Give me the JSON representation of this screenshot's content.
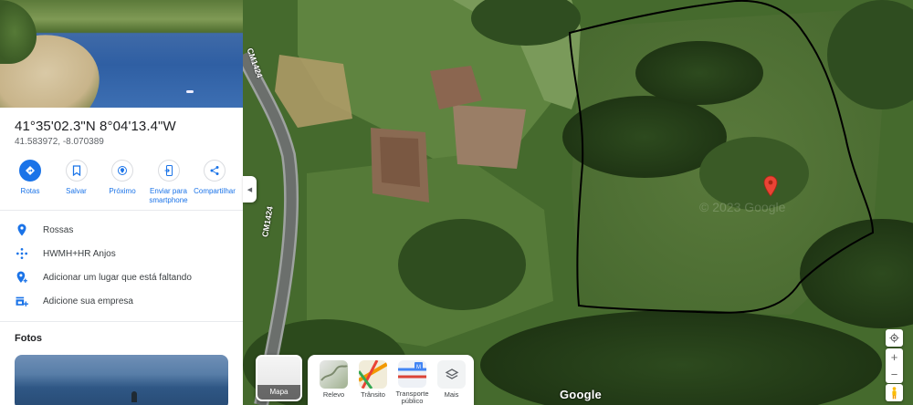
{
  "place": {
    "coords_dms": "41°35'02.3\"N 8°04'13.4\"W",
    "coords_decimal": "41.583972, -8.070389"
  },
  "actions": [
    {
      "label": "Rotas",
      "icon": "directions-icon"
    },
    {
      "label": "Salvar",
      "icon": "bookmark-icon"
    },
    {
      "label": "Próximo",
      "icon": "nearby-icon"
    },
    {
      "label": "Enviar para smartphone",
      "icon": "send-to-phone-icon"
    },
    {
      "label": "Compartilhar",
      "icon": "share-icon"
    }
  ],
  "info": [
    {
      "text": "Rossas",
      "icon": "location-pin-icon"
    },
    {
      "text": "HWMH+HR Anjos",
      "icon": "plus-code-icon"
    },
    {
      "text": "Adicionar um lugar que está faltando",
      "icon": "add-place-icon"
    },
    {
      "text": "Adicione sua empresa",
      "icon": "add-business-icon"
    }
  ],
  "photos_title": "Fotos",
  "map": {
    "road_label_top": "CM1424",
    "road_label_side": "CM1424",
    "watermark": "© 2023 Google",
    "logo": "Google"
  },
  "layers": {
    "current_label": "Mapa",
    "items": [
      {
        "label": "Relevo"
      },
      {
        "label": "Trânsito"
      },
      {
        "label": "Transporte público"
      },
      {
        "label": "Mais"
      }
    ]
  },
  "colors": {
    "accent": "#1a73e8",
    "marker": "#ea4335",
    "boundary": "#000000"
  }
}
